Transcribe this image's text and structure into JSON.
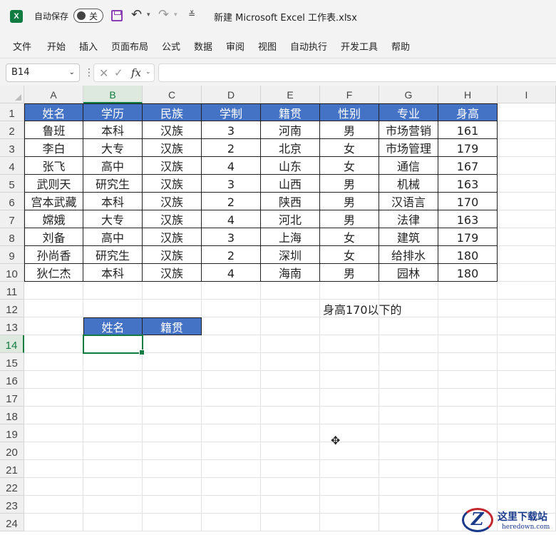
{
  "titlebar": {
    "app_icon": "excel-logo-icon",
    "autosave_label": "自动保存",
    "autosave_state": "关",
    "document_title": "新建 Microsoft Excel 工作表.xlsx"
  },
  "ribbon": {
    "tabs": [
      "文件",
      "开始",
      "插入",
      "页面布局",
      "公式",
      "数据",
      "审阅",
      "视图",
      "自动执行",
      "开发工具",
      "帮助"
    ]
  },
  "formula_bar": {
    "name_box": "B14",
    "formula": ""
  },
  "sheet": {
    "columns": [
      "A",
      "B",
      "C",
      "D",
      "E",
      "F",
      "G",
      "H",
      "I"
    ],
    "rows": [
      "1",
      "2",
      "3",
      "4",
      "5",
      "6",
      "7",
      "8",
      "9",
      "10",
      "11",
      "12",
      "13",
      "14",
      "15",
      "16",
      "17",
      "18",
      "19",
      "20",
      "21",
      "22",
      "23",
      "24"
    ],
    "selected_column": "B",
    "selected_row": "14",
    "table_header": [
      "姓名",
      "学历",
      "民族",
      "学制",
      "籍贯",
      "性别",
      "专业",
      "身高"
    ],
    "table_rows": [
      [
        "鲁班",
        "本科",
        "汉族",
        "3",
        "河南",
        "男",
        "市场营销",
        "161"
      ],
      [
        "李白",
        "大专",
        "汉族",
        "2",
        "北京",
        "女",
        "市场管理",
        "179"
      ],
      [
        "张飞",
        "高中",
        "汉族",
        "4",
        "山东",
        "女",
        "通信",
        "167"
      ],
      [
        "武则天",
        "研究生",
        "汉族",
        "3",
        "山西",
        "男",
        "机械",
        "163"
      ],
      [
        "宫本武藏",
        "本科",
        "汉族",
        "2",
        "陕西",
        "男",
        "汉语言",
        "170"
      ],
      [
        "嫦娥",
        "大专",
        "汉族",
        "4",
        "河北",
        "男",
        "法律",
        "163"
      ],
      [
        "刘备",
        "高中",
        "汉族",
        "3",
        "上海",
        "女",
        "建筑",
        "179"
      ],
      [
        "孙尚香",
        "研究生",
        "汉族",
        "2",
        "深圳",
        "女",
        "给排水",
        "180"
      ],
      [
        "狄仁杰",
        "本科",
        "汉族",
        "4",
        "海南",
        "男",
        "园林",
        "180"
      ]
    ],
    "note": "身高170以下的",
    "result_header": [
      "姓名",
      "籍贯"
    ]
  },
  "watermark": {
    "title": "这里下载站",
    "subtitle": "heredown.com"
  },
  "colors": {
    "header_fill": "#4472c4",
    "selection": "#107c41"
  }
}
